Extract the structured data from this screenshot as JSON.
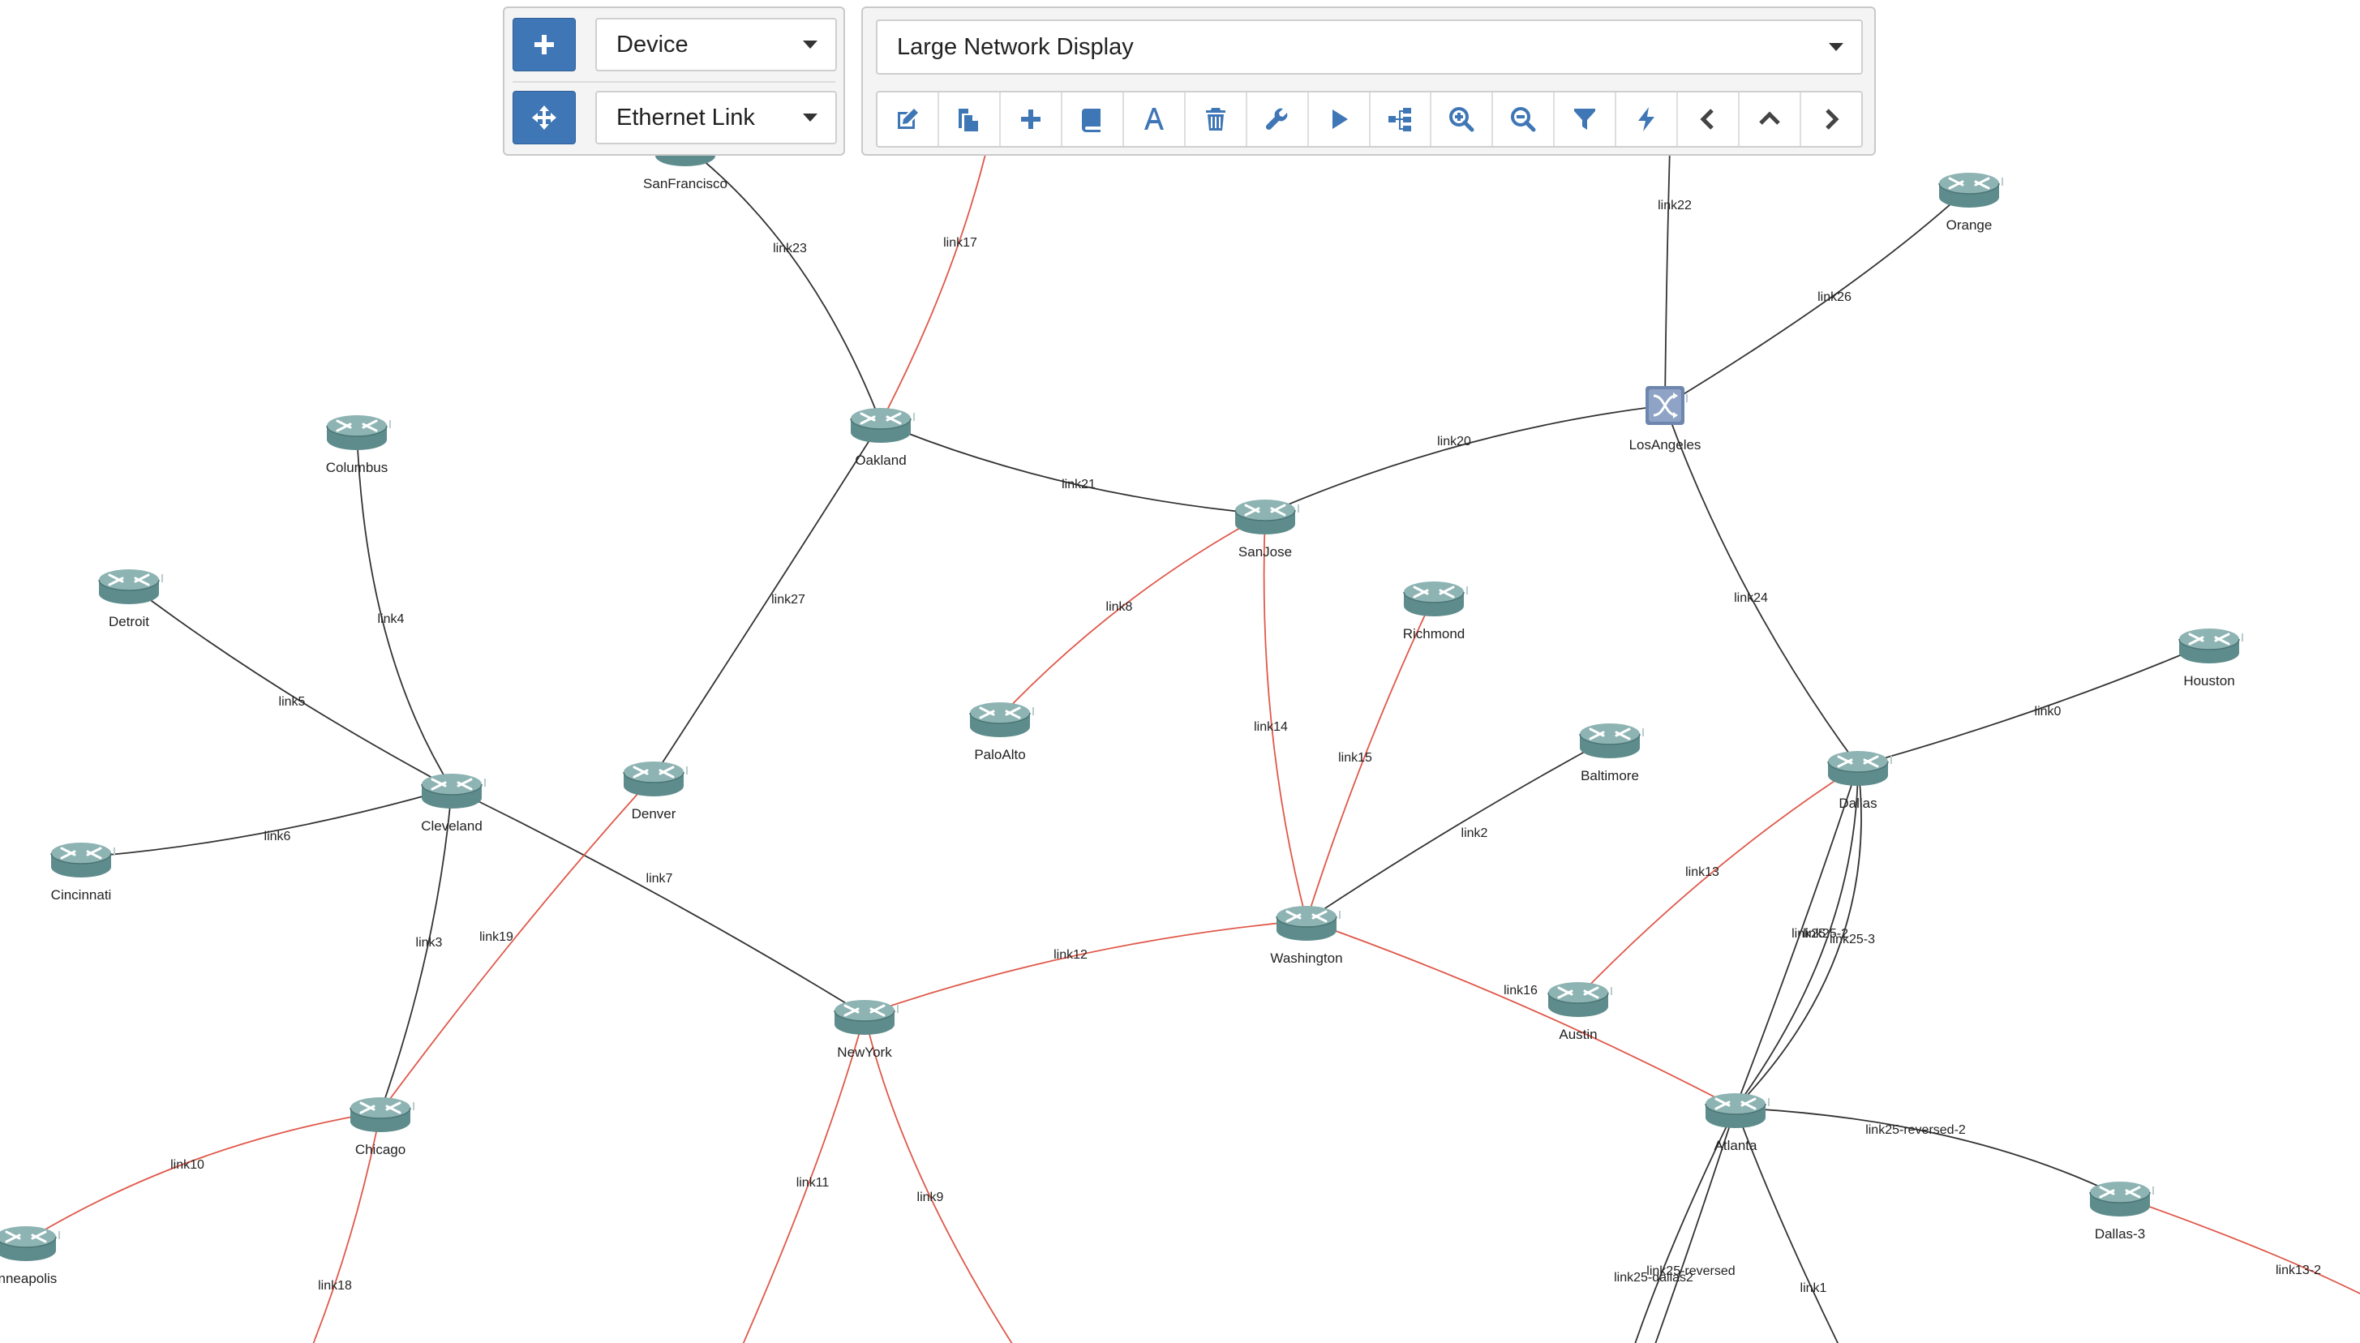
{
  "controls": {
    "add_icon": "plus-icon",
    "move_icon": "move-arrows-icon",
    "device_type": "Device",
    "link_type": "Ethernet Link",
    "view_select": "Large Network Display"
  },
  "toolbar": [
    {
      "name": "edit",
      "icon": "edit-icon"
    },
    {
      "name": "copy",
      "icon": "copy-icon"
    },
    {
      "name": "add",
      "icon": "plus-icon"
    },
    {
      "name": "book",
      "icon": "book-icon"
    },
    {
      "name": "text",
      "icon": "font-icon"
    },
    {
      "name": "delete",
      "icon": "trash-icon"
    },
    {
      "name": "settings",
      "icon": "wrench-icon"
    },
    {
      "name": "run",
      "icon": "play-icon"
    },
    {
      "name": "tree",
      "icon": "sitemap-icon"
    },
    {
      "name": "zoom-in",
      "icon": "zoom-in-icon"
    },
    {
      "name": "zoom-out",
      "icon": "zoom-out-icon"
    },
    {
      "name": "filter",
      "icon": "filter-icon"
    },
    {
      "name": "power",
      "icon": "bolt-icon"
    },
    {
      "name": "previous",
      "icon": "chevron-left-icon"
    },
    {
      "name": "up",
      "icon": "chevron-up-icon"
    },
    {
      "name": "next",
      "icon": "chevron-right-icon"
    }
  ],
  "colors": {
    "accent": "#3f76b5",
    "router": "#5e8c8c",
    "link_black": "#333333",
    "link_red": "#e0584a"
  },
  "network": {
    "nodes": [
      {
        "id": "SanFrancisco",
        "label": "SanFrancisco",
        "type": "router"
      },
      {
        "id": "Oakland",
        "label": "Oakland",
        "type": "router"
      },
      {
        "id": "SanJose",
        "label": "SanJose",
        "type": "router"
      },
      {
        "id": "LosAngeles",
        "label": "LosAngeles",
        "type": "switch"
      },
      {
        "id": "Orange",
        "label": "Orange",
        "type": "router"
      },
      {
        "id": "Columbus",
        "label": "Columbus",
        "type": "router"
      },
      {
        "id": "Detroit",
        "label": "Detroit",
        "type": "router"
      },
      {
        "id": "Cleveland",
        "label": "Cleveland",
        "type": "router"
      },
      {
        "id": "Cincinnati",
        "label": "Cincinnati",
        "type": "router"
      },
      {
        "id": "Denver",
        "label": "Denver",
        "type": "router"
      },
      {
        "id": "PaloAlto",
        "label": "PaloAlto",
        "type": "router"
      },
      {
        "id": "Richmond",
        "label": "Richmond",
        "type": "router"
      },
      {
        "id": "Baltimore",
        "label": "Baltimore",
        "type": "router"
      },
      {
        "id": "Houston",
        "label": "Houston",
        "type": "router"
      },
      {
        "id": "Dallas",
        "label": "Dallas",
        "type": "router"
      },
      {
        "id": "Washington",
        "label": "Washington",
        "type": "router"
      },
      {
        "id": "NewYork",
        "label": "NewYork",
        "type": "router"
      },
      {
        "id": "Austin",
        "label": "Austin",
        "type": "router"
      },
      {
        "id": "Atlanta",
        "label": "Atlanta",
        "type": "router"
      },
      {
        "id": "Chicago",
        "label": "Chicago",
        "type": "router"
      },
      {
        "id": "Minneapolis",
        "label": "inneapolis",
        "type": "router"
      },
      {
        "id": "Dallas-3",
        "label": "Dallas-3",
        "type": "router"
      }
    ],
    "links": [
      {
        "label": "link23",
        "from": "SanFrancisco",
        "to": "Oakland",
        "color": "black"
      },
      {
        "label": "link17",
        "to": "Oakland",
        "color": "red"
      },
      {
        "label": "link22",
        "to": "LosAngeles",
        "color": "black"
      },
      {
        "label": "link26",
        "from": "Orange",
        "to": "LosAngeles",
        "color": "black"
      },
      {
        "label": "link21",
        "from": "Oakland",
        "to": "SanJose",
        "color": "black"
      },
      {
        "label": "link20",
        "from": "SanJose",
        "to": "LosAngeles",
        "color": "black"
      },
      {
        "label": "link27",
        "from": "Oakland",
        "to": "Denver",
        "color": "black"
      },
      {
        "label": "link8",
        "from": "SanJose",
        "to": "PaloAlto",
        "color": "red"
      },
      {
        "label": "link14",
        "from": "SanJose",
        "to": "Washington",
        "color": "red"
      },
      {
        "label": "link15",
        "from": "Richmond",
        "to": "Washington",
        "color": "red"
      },
      {
        "label": "link24",
        "from": "LosAngeles",
        "to": "Dallas",
        "color": "black"
      },
      {
        "label": "link0",
        "from": "Houston",
        "to": "Dallas",
        "color": "black"
      },
      {
        "label": "link4",
        "from": "Columbus",
        "to": "Cleveland",
        "color": "black"
      },
      {
        "label": "link5",
        "from": "Detroit",
        "to": "Cleveland",
        "color": "black"
      },
      {
        "label": "link6",
        "from": "Cincinnati",
        "to": "Cleveland",
        "color": "black"
      },
      {
        "label": "link7",
        "from": "Cleveland",
        "to": "NewYork",
        "color": "black"
      },
      {
        "label": "link3",
        "from": "Cleveland",
        "to": "Chicago",
        "color": "black"
      },
      {
        "label": "link19",
        "from": "Denver",
        "to": "Chicago",
        "color": "red"
      },
      {
        "label": "link2",
        "from": "Baltimore",
        "to": "Washington",
        "color": "black"
      },
      {
        "label": "link12",
        "from": "NewYork",
        "to": "Washington",
        "color": "red"
      },
      {
        "label": "link16",
        "from": "Washington",
        "to": "Atlanta",
        "color": "red"
      },
      {
        "label": "link13",
        "from": "Dallas",
        "to": "Austin",
        "color": "red"
      },
      {
        "label": "link25-2",
        "from": "Dallas",
        "to": "Atlanta",
        "color": "black"
      },
      {
        "label": "link25-3",
        "from": "Dallas",
        "to": "Atlanta",
        "color": "black"
      },
      {
        "label": "link25",
        "from": "Dallas",
        "to": "Atlanta",
        "color": "black"
      },
      {
        "label": "link25-reversed-2",
        "from": "Atlanta",
        "to": "Dallas-3",
        "color": "black"
      },
      {
        "label": "link25-reversed",
        "from": "Atlanta",
        "color": "black"
      },
      {
        "label": "link25-dallas2",
        "from": "Atlanta",
        "color": "black"
      },
      {
        "label": "link1",
        "from": "Atlanta",
        "color": "black"
      },
      {
        "label": "link13-2",
        "from": "Dallas-3",
        "color": "red"
      },
      {
        "label": "link10",
        "from": "Chicago",
        "to": "Minneapolis",
        "color": "red"
      },
      {
        "label": "link18",
        "from": "Chicago",
        "color": "red"
      },
      {
        "label": "link11",
        "from": "NewYork",
        "color": "red"
      },
      {
        "label": "link9",
        "from": "NewYork",
        "color": "red"
      }
    ]
  }
}
